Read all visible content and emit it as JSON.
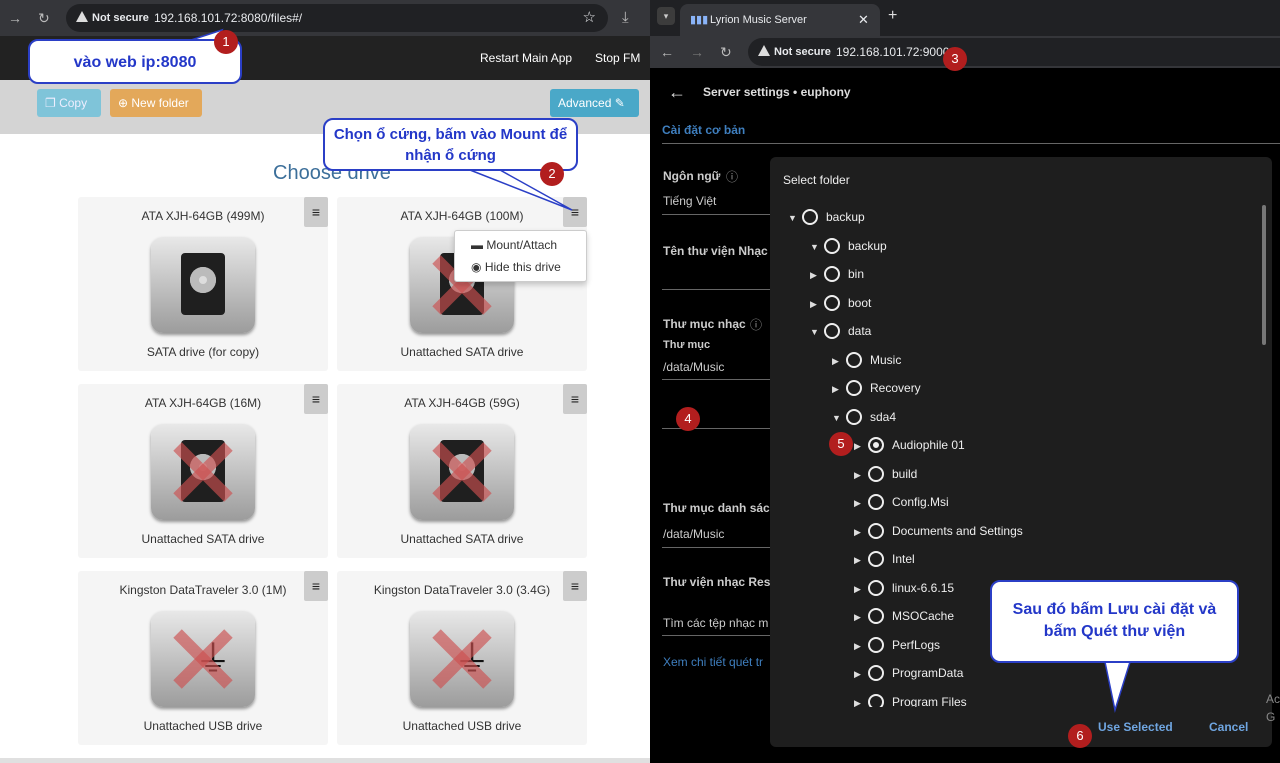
{
  "left_browser": {
    "url_warning": "Not secure",
    "url": "192.168.101.72:8080/files#/",
    "nav": {
      "restart": "Restart Main App",
      "stop": "Stop FM"
    },
    "toolbar": {
      "copy": "Copy",
      "new_folder": "New folder",
      "advanced": "Advanced"
    },
    "heading": "Choose drive",
    "dropdown": {
      "mount": "Mount/Attach",
      "hide": "Hide this drive"
    },
    "drives": [
      {
        "name": "ATA XJH-64GB (499M)",
        "label": "SATA drive (for copy)"
      },
      {
        "name": "ATA XJH-64GB (100M)",
        "label": "Unattached SATA drive"
      },
      {
        "name": "ATA XJH-64GB (16M)",
        "label": "Unattached SATA drive"
      },
      {
        "name": "ATA XJH-64GB (59G)",
        "label": "Unattached SATA drive"
      },
      {
        "name": "Kingston DataTraveler 3.0 (1M)",
        "label": "Unattached USB drive"
      },
      {
        "name": "Kingston DataTraveler 3.0 (3.4G)",
        "label": "Unattached USB drive"
      }
    ],
    "menu_glyph": "≡"
  },
  "right_browser": {
    "tab_title": "Lyrion Music Server",
    "url_warning": "Not secure",
    "url": "192.168.101.72:9000",
    "page_title": "Server settings • euphony",
    "section": "Cài đặt cơ bản",
    "settings": {
      "language_label": "Ngôn ngữ",
      "language_value": "Tiếng Việt",
      "library_label": "Tên thư viện Nhạc",
      "music_folder_label": "Thư mục nhạc",
      "folder_label": "Thư mục",
      "folder_value": "/data/Music",
      "playlist_label": "Thư mục danh sách",
      "playlist_value": "/data/Music",
      "rescan_label": "Thư viện nhạc Resc",
      "find_label": "Tìm các tệp nhạc m",
      "details_link": "Xem chi tiết quét tr"
    },
    "dialog": {
      "title": "Select folder",
      "tree": [
        {
          "name": "backup",
          "level": 0,
          "expanded": true,
          "selected": false
        },
        {
          "name": "backup",
          "level": 1,
          "expanded": true,
          "selected": false
        },
        {
          "name": "bin",
          "level": 1,
          "expanded": false,
          "selected": false
        },
        {
          "name": "boot",
          "level": 1,
          "expanded": false,
          "selected": false
        },
        {
          "name": "data",
          "level": 1,
          "expanded": true,
          "selected": false
        },
        {
          "name": "Music",
          "level": 2,
          "expanded": false,
          "selected": false
        },
        {
          "name": "Recovery",
          "level": 2,
          "expanded": false,
          "selected": false
        },
        {
          "name": "sda4",
          "level": 2,
          "expanded": true,
          "selected": false
        },
        {
          "name": "Audiophile 01",
          "level": 3,
          "expanded": false,
          "selected": true
        },
        {
          "name": "build",
          "level": 3,
          "expanded": false,
          "selected": false
        },
        {
          "name": "Config.Msi",
          "level": 3,
          "expanded": false,
          "selected": false
        },
        {
          "name": "Documents and Settings",
          "level": 3,
          "expanded": false,
          "selected": false
        },
        {
          "name": "Intel",
          "level": 3,
          "expanded": false,
          "selected": false
        },
        {
          "name": "linux-6.6.15",
          "level": 3,
          "expanded": false,
          "selected": false
        },
        {
          "name": "MSOCache",
          "level": 3,
          "expanded": false,
          "selected": false
        },
        {
          "name": "PerfLogs",
          "level": 3,
          "expanded": false,
          "selected": false
        },
        {
          "name": "ProgramData",
          "level": 3,
          "expanded": false,
          "selected": false
        },
        {
          "name": "Program Files",
          "level": 3,
          "expanded": false,
          "selected": false
        }
      ],
      "use_selected": "Use Selected",
      "cancel": "Cancel"
    },
    "edge_text": "Ac G"
  },
  "annotations": {
    "callout1": "vào web ip:8080",
    "callout2": "Chọn ổ cứng, bấm vào Mount để nhận ổ cứng",
    "callout3": "Sau đó bấm Lưu cài đặt và bấm Quét thư viện",
    "badges": [
      "1",
      "2",
      "3",
      "4",
      "5",
      "6"
    ]
  },
  "colors": {
    "accent": "#5bc0de",
    "new_folder": "#f0ad4e",
    "callout_border": "#2b3fc6",
    "badge": "#b21e1e",
    "link": "#3f7fbf"
  }
}
